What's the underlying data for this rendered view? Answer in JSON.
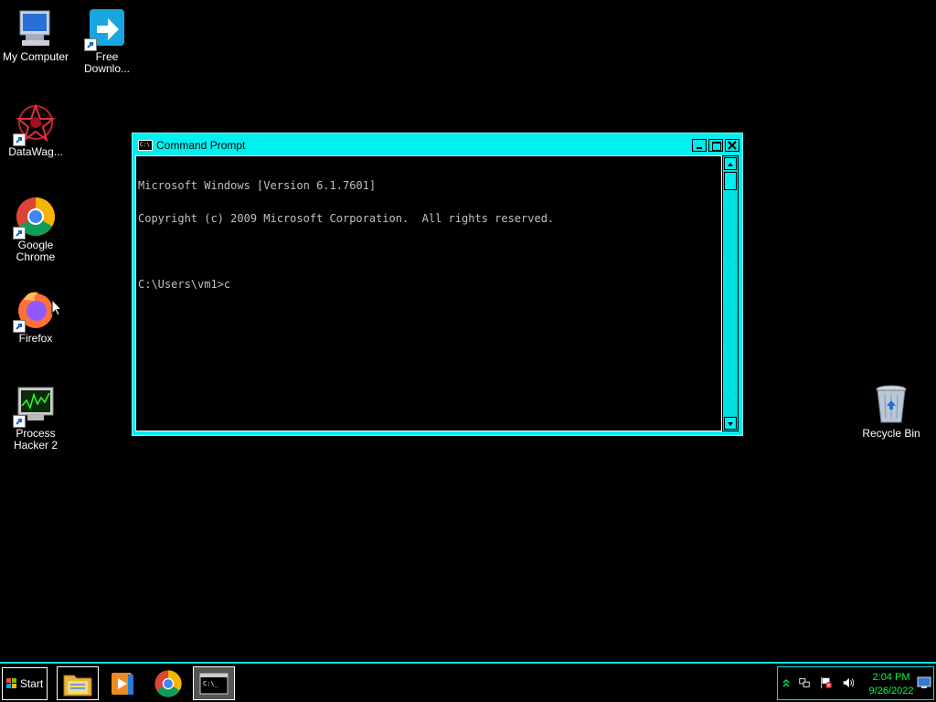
{
  "desktop": {
    "icons": [
      {
        "label": "My Computer",
        "icon": "computer-icon"
      },
      {
        "label": "Free\nDownlo...",
        "icon": "download-manager-icon"
      },
      {
        "label": "DataWag...",
        "icon": "datawag-icon"
      },
      {
        "label": "Google\nChrome",
        "icon": "chrome-icon"
      },
      {
        "label": "Firefox",
        "icon": "firefox-icon"
      },
      {
        "label": "Process\nHacker 2",
        "icon": "process-hacker-icon"
      },
      {
        "label": "Recycle Bin",
        "icon": "recycle-bin-icon"
      }
    ]
  },
  "window": {
    "title": "Command Prompt",
    "console_lines": [
      "Microsoft Windows [Version 6.1.7601]",
      "Copyright (c) 2009 Microsoft Corporation.  All rights reserved.",
      "",
      "C:\\Users\\vm1>c"
    ]
  },
  "taskbar": {
    "start_label": "Start",
    "items": [
      "file-explorer-icon",
      "media-player-icon",
      "chrome-icon",
      "command-prompt-icon"
    ],
    "clock_time": "2:04 PM",
    "clock_date": "9/26/2022"
  },
  "colors": {
    "accent": "#00f0f0",
    "clock": "#00ff40",
    "console_text": "#c0c0c0"
  }
}
